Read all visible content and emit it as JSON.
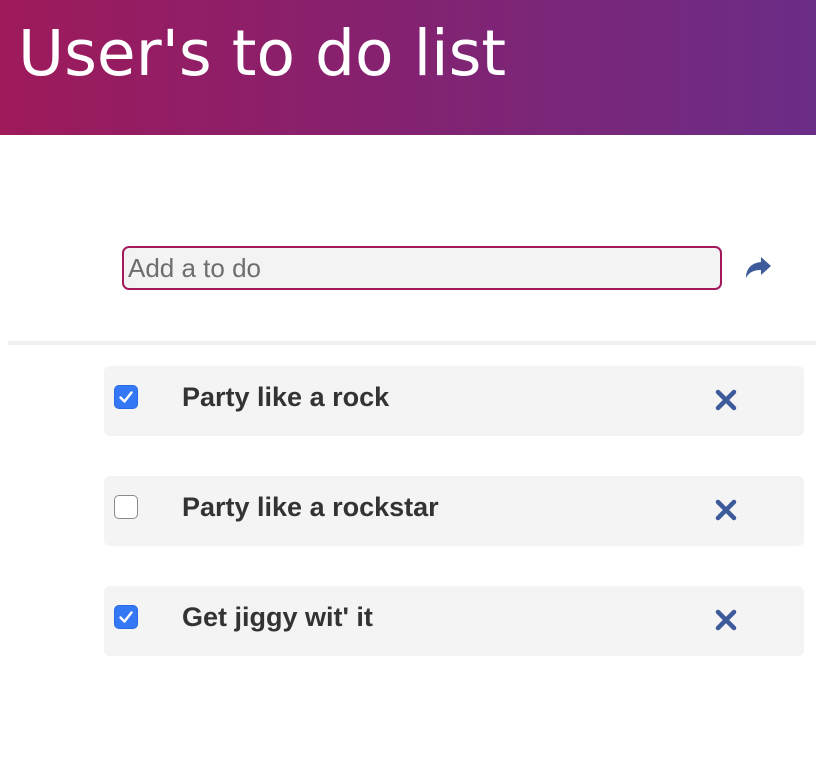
{
  "header": {
    "title": "User's to do list"
  },
  "add_form": {
    "placeholder": "Add a to do",
    "value": "",
    "submit_icon": "share-arrow-icon"
  },
  "todos": [
    {
      "text": "Party like a rock",
      "checked": true,
      "delete_icon": "close-icon"
    },
    {
      "text": "Party like a rockstar",
      "checked": false,
      "delete_icon": "close-icon"
    },
    {
      "text": "Get jiggy wit' it",
      "checked": true,
      "delete_icon": "close-icon"
    }
  ],
  "colors": {
    "header_gradient_start": "#9e1a5b",
    "header_gradient_end": "#6b2d87",
    "input_border": "#a3195b",
    "icon_color": "#3d5a9a",
    "checkbox_checked": "#3478f6",
    "item_background": "#f4f4f4"
  }
}
